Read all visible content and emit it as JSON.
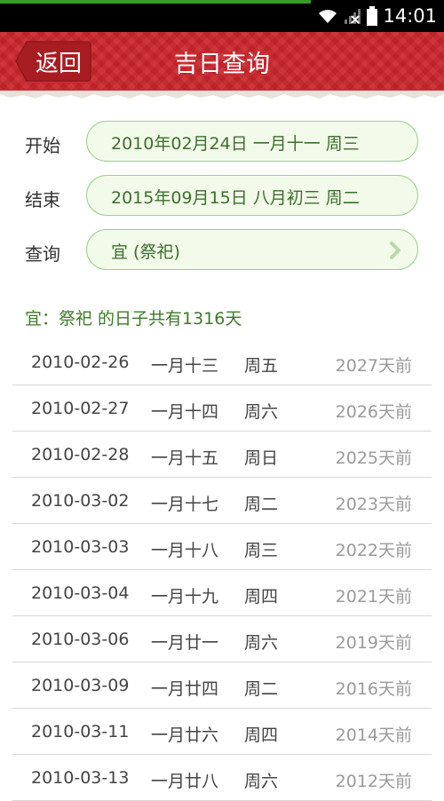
{
  "status_bar": {
    "time": "14:01",
    "icons": [
      "wifi-icon",
      "signal-icon",
      "battery-icon"
    ],
    "progress_fraction": 0.7
  },
  "header": {
    "back_label": "返回",
    "title": "吉日查询"
  },
  "form": {
    "start_label": "开始",
    "start_value": "2010年02月24日 一月十一 周三",
    "end_label": "结束",
    "end_value": "2015年09月15日 八月初三 周二",
    "query_label": "查询",
    "query_value": "宜 (祭祀)"
  },
  "summary": "宜：祭祀 的日子共有1316天",
  "rows": [
    {
      "date": "2010-02-26",
      "lunar": "一月十三",
      "weekday": "周五",
      "ago": "2027天前"
    },
    {
      "date": "2010-02-27",
      "lunar": "一月十四",
      "weekday": "周六",
      "ago": "2026天前"
    },
    {
      "date": "2010-02-28",
      "lunar": "一月十五",
      "weekday": "周日",
      "ago": "2025天前"
    },
    {
      "date": "2010-03-02",
      "lunar": "一月十七",
      "weekday": "周二",
      "ago": "2023天前"
    },
    {
      "date": "2010-03-03",
      "lunar": "一月十八",
      "weekday": "周三",
      "ago": "2022天前"
    },
    {
      "date": "2010-03-04",
      "lunar": "一月十九",
      "weekday": "周四",
      "ago": "2021天前"
    },
    {
      "date": "2010-03-06",
      "lunar": "一月廿一",
      "weekday": "周六",
      "ago": "2019天前"
    },
    {
      "date": "2010-03-09",
      "lunar": "一月廿四",
      "weekday": "周二",
      "ago": "2016天前"
    },
    {
      "date": "2010-03-11",
      "lunar": "一月廿六",
      "weekday": "周四",
      "ago": "2014天前"
    },
    {
      "date": "2010-03-13",
      "lunar": "一月廿八",
      "weekday": "周六",
      "ago": "2012天前"
    }
  ],
  "colors": {
    "header_red": "#c9252b",
    "pill_border": "#9ccf8c",
    "pill_bg": "#f2fbe9",
    "accent_green": "#3d7a26"
  }
}
